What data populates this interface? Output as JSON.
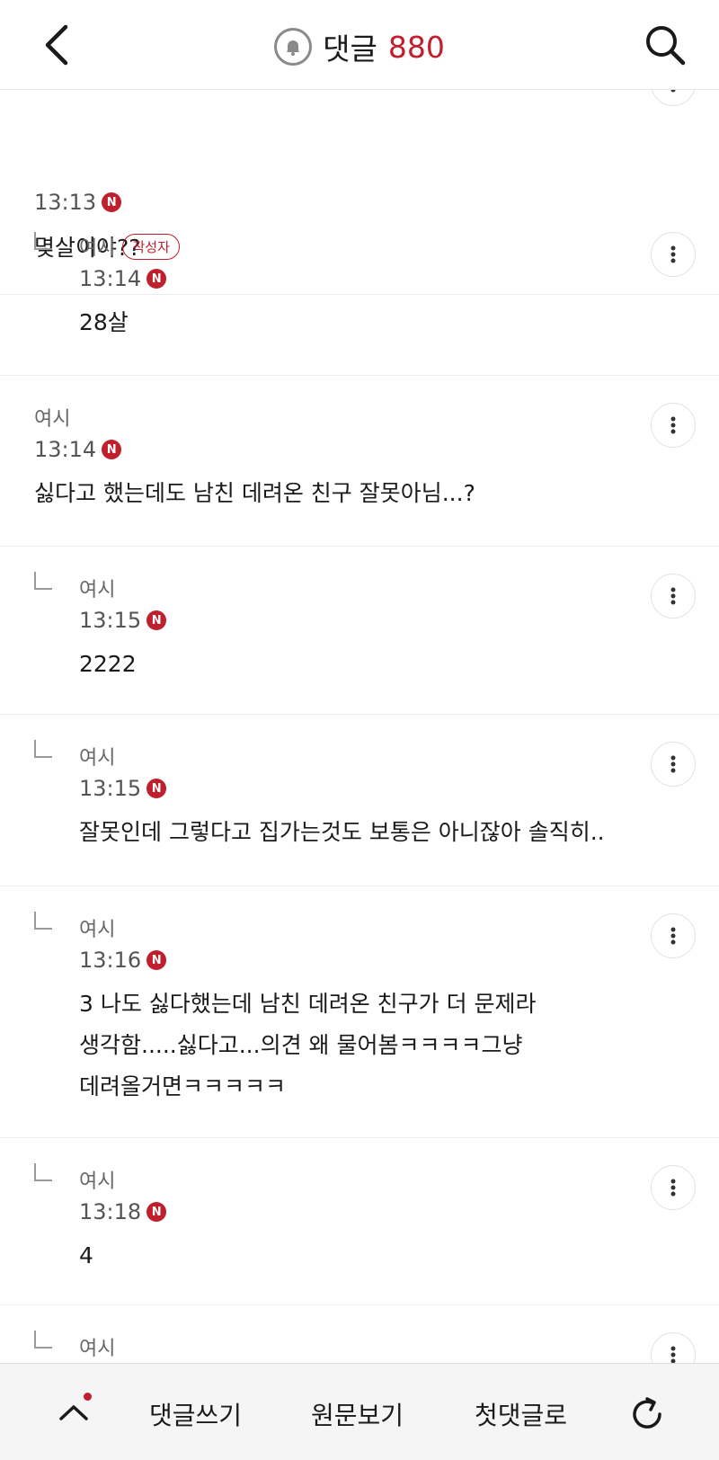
{
  "header": {
    "back_icon": "chevron-left-icon",
    "bell_icon": "bell-icon",
    "title": "댓글",
    "count": "880",
    "search_icon": "search-icon",
    "accent_color": "#c01f2d"
  },
  "comments": [
    {
      "is_reply": false,
      "author": "",
      "time": "13:13",
      "new_badge": "N",
      "text": "몇살이야??"
    },
    {
      "is_reply": true,
      "author": "여시",
      "author_badge": "작성자",
      "time": "13:14",
      "new_badge": "N",
      "text": "28살"
    },
    {
      "is_reply": false,
      "author": "여시",
      "time": "13:14",
      "new_badge": "N",
      "text": "싫다고 했는데도 남친 데려온 친구 잘못아님...?"
    },
    {
      "is_reply": true,
      "author": "여시",
      "time": "13:15",
      "new_badge": "N",
      "text": "2222"
    },
    {
      "is_reply": true,
      "author": "여시",
      "time": "13:15",
      "new_badge": "N",
      "text": "잘못인데 그렇다고 집가는것도 보통은 아니잖아 솔직히.."
    },
    {
      "is_reply": true,
      "author": "여시",
      "time": "13:16",
      "new_badge": "N",
      "text_lines": [
        "3 나도 싫다했는데 남친 데려온 친구가 더 문제라",
        "생각함.....싫다고...의견 왜 물어봄ㅋㅋㅋㅋ그냥",
        "데려올거면ㅋㅋㅋㅋㅋ"
      ]
    },
    {
      "is_reply": true,
      "author": "여시",
      "time": "13:18",
      "new_badge": "N",
      "text": "4"
    },
    {
      "is_reply": true,
      "author": "여시",
      "time": "",
      "new_badge": "",
      "text": ""
    }
  ],
  "bottom_bar": {
    "up_icon": "chevron-up-icon",
    "write_label": "댓글쓰기",
    "original_label": "원문보기",
    "first_label": "첫댓글로",
    "refresh_icon": "refresh-icon"
  }
}
